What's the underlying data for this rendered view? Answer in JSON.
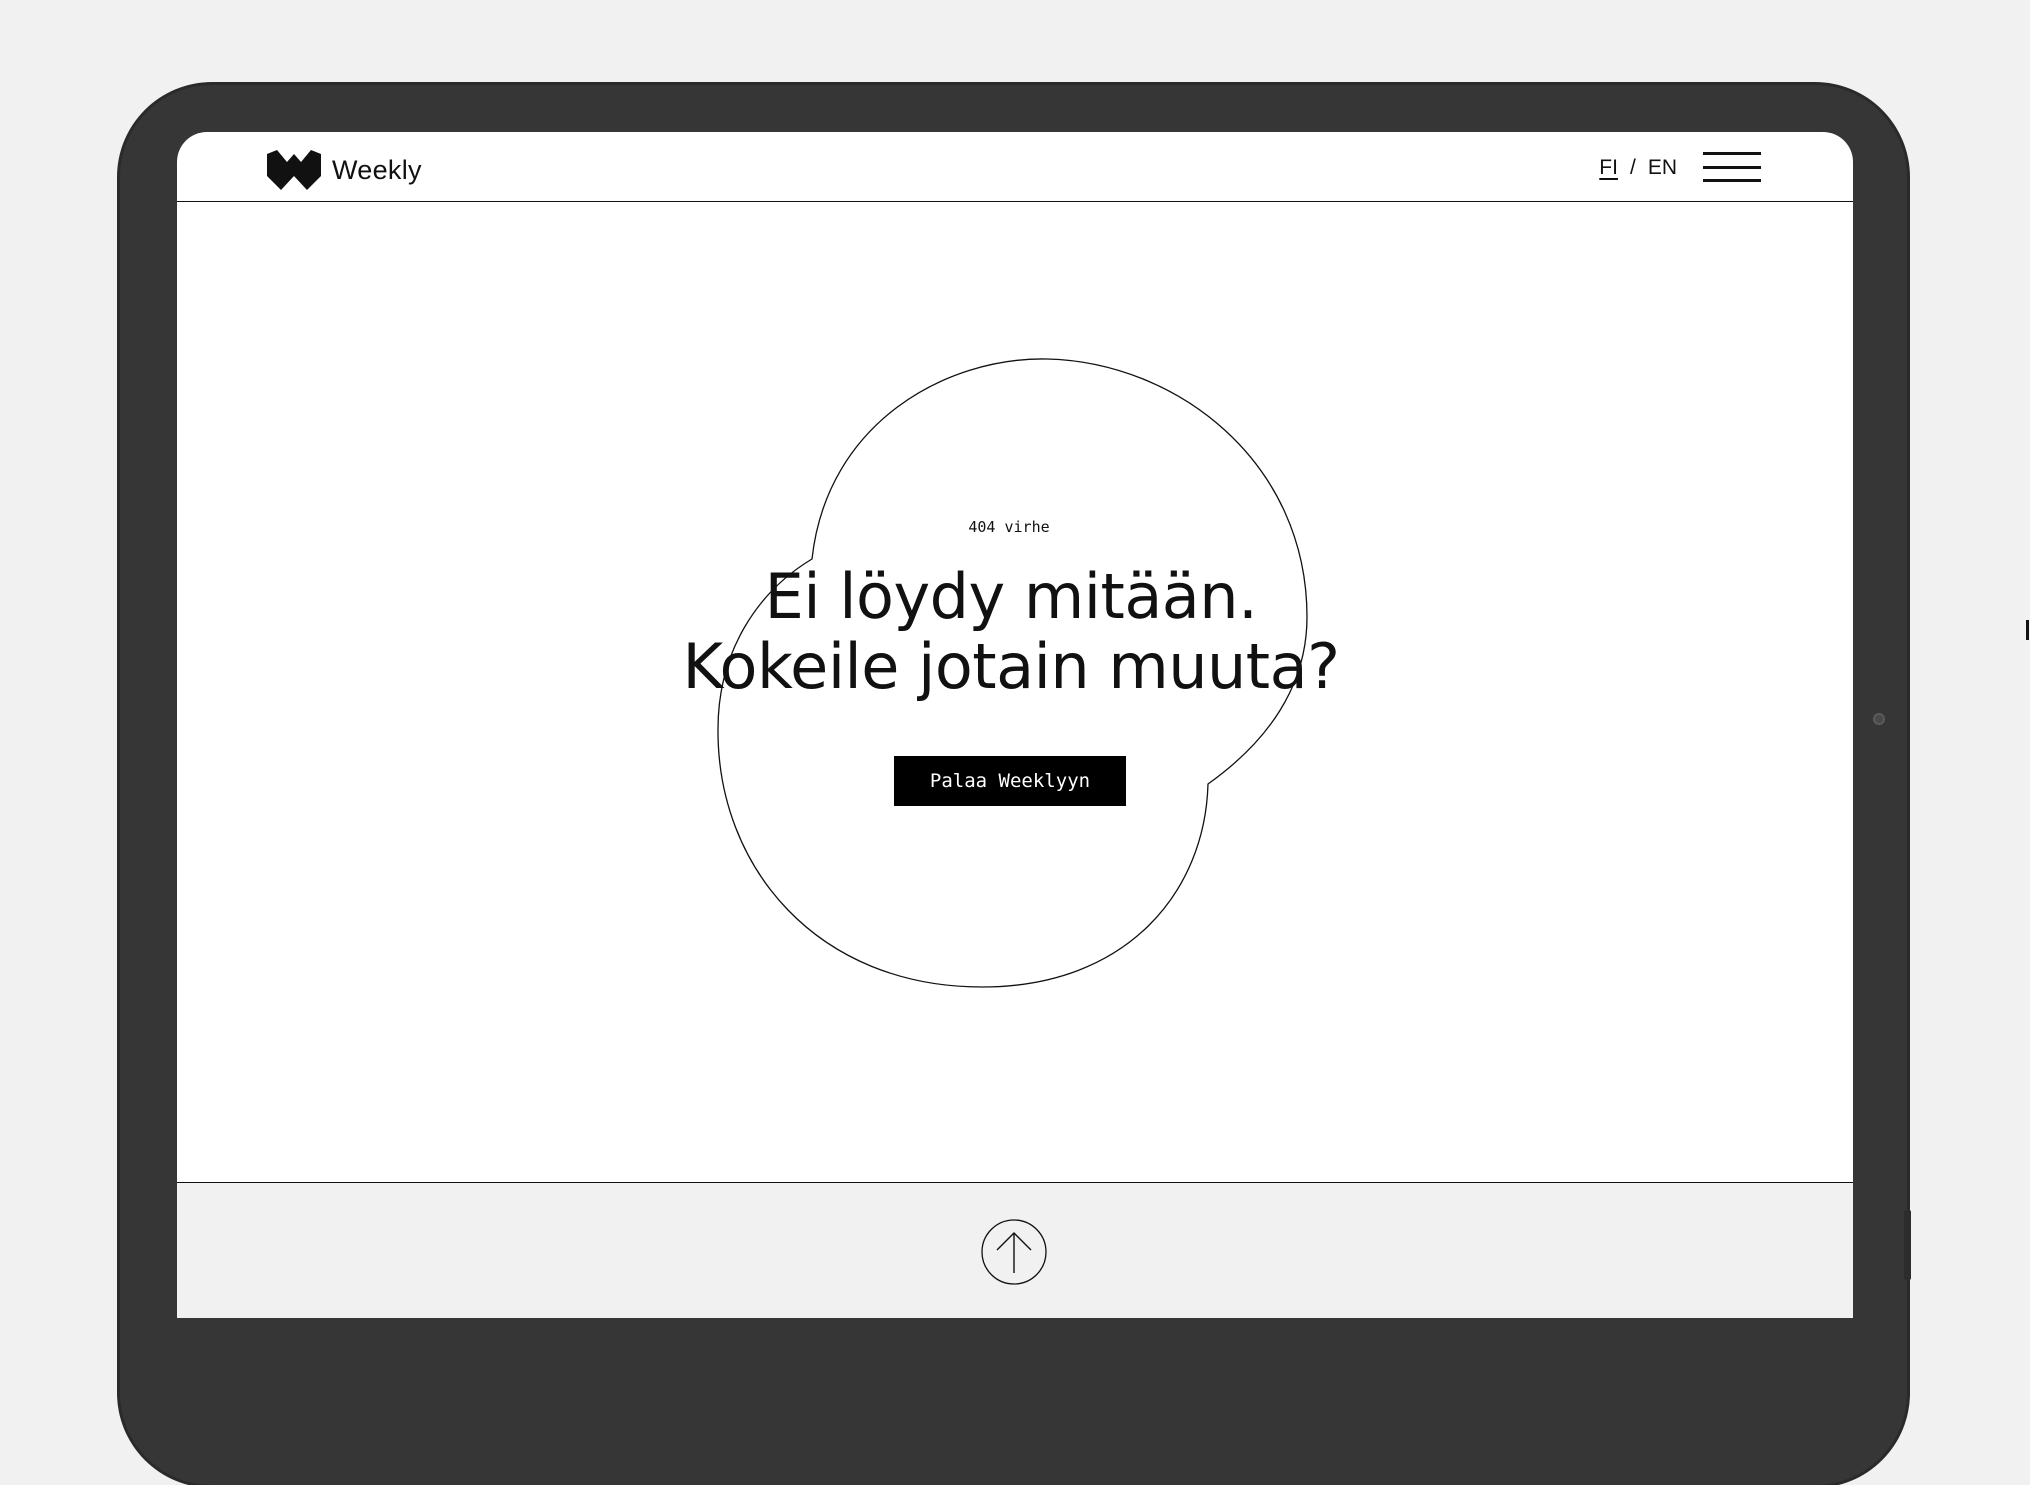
{
  "header": {
    "brand": "Weekly",
    "languages": [
      {
        "code": "FI",
        "active": true
      },
      {
        "code": "EN",
        "active": false
      }
    ],
    "separator": "/"
  },
  "main": {
    "error_code": "404 virhe",
    "headline_line1": "Ei löydy mitään.",
    "headline_line2": "Kokeile jotain muuta?",
    "button_label": "Palaa Weeklyyn"
  },
  "icons": {
    "logo": "weekly-w-logo-icon",
    "menu": "hamburger-menu-icon",
    "back_to_top": "arrow-up-circle-icon"
  },
  "colors": {
    "page_background": "#f1f1f1",
    "device_frame": "#363636",
    "screen": "#ffffff",
    "text": "#111111",
    "button_background": "#000000",
    "button_text": "#ffffff"
  }
}
